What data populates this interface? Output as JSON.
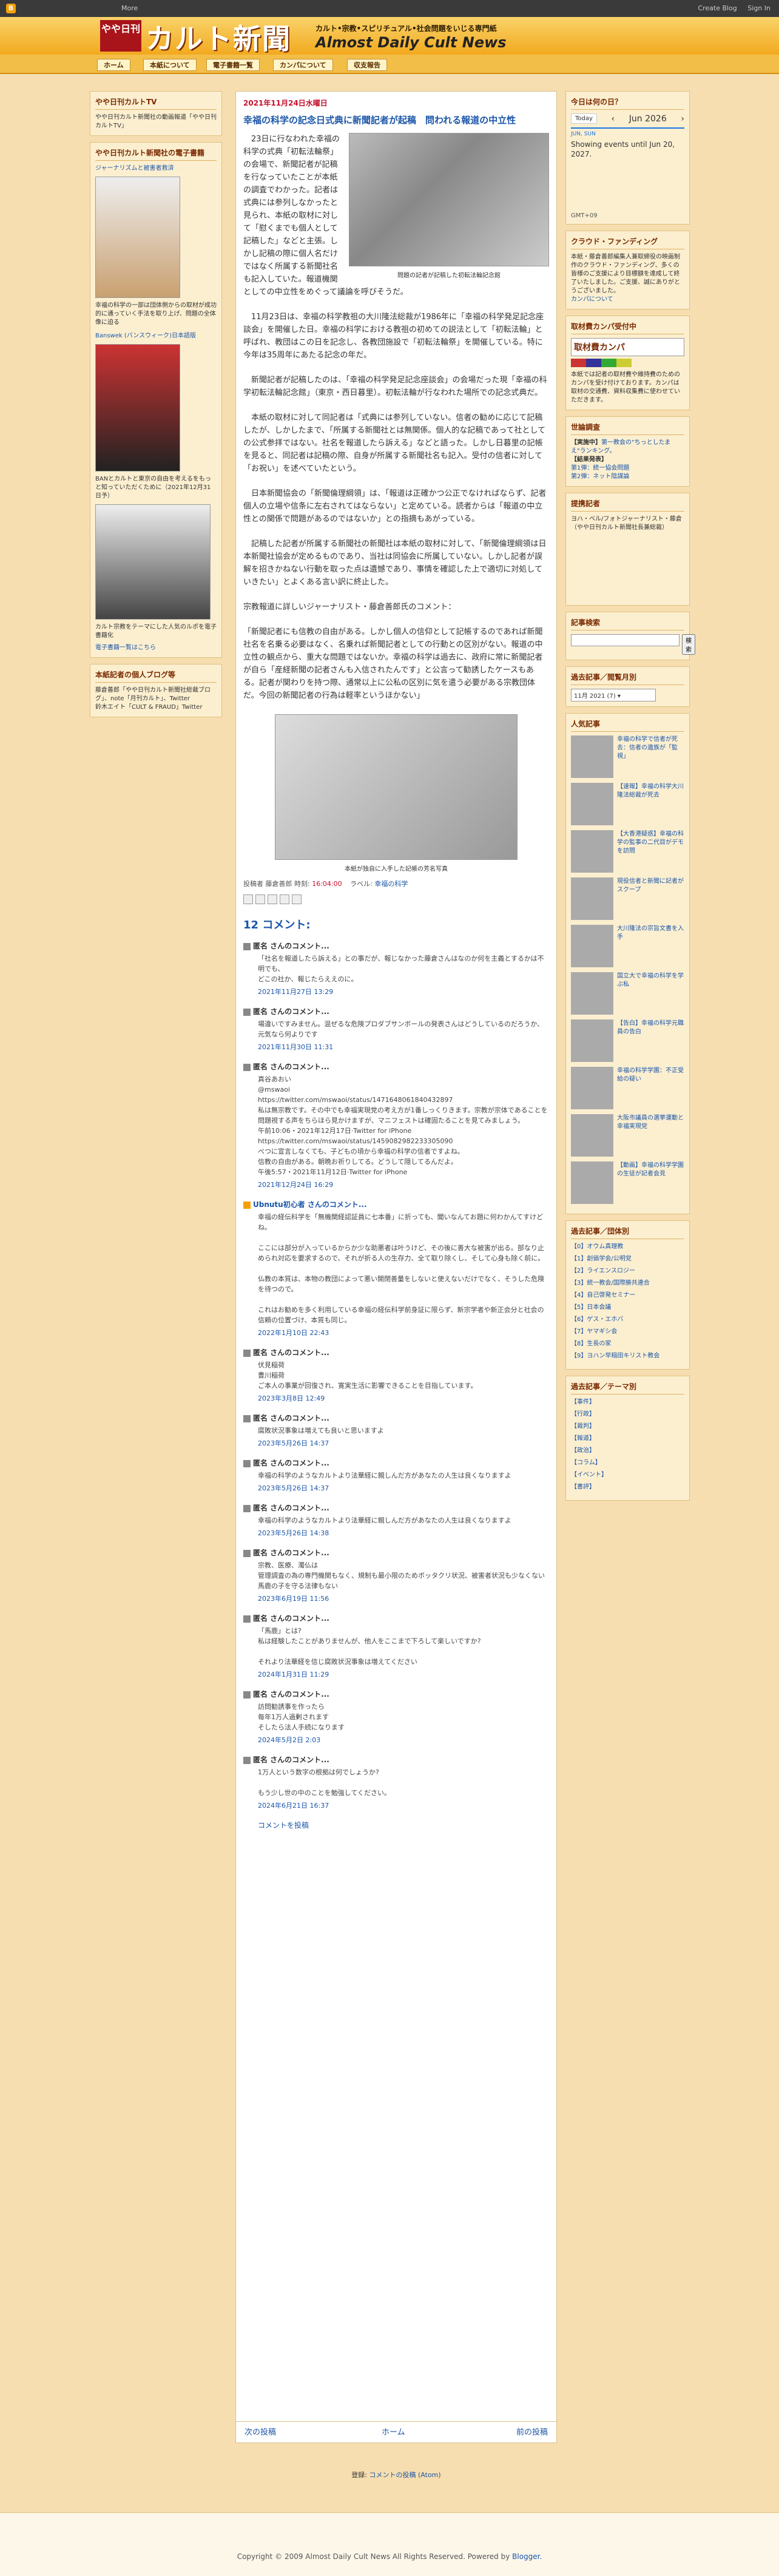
{
  "navbar": {
    "more": "More",
    "create_blog": "Create Blog",
    "sign_in": "Sign In"
  },
  "header": {
    "logo_box": "やや日刊",
    "logo_text": "カルト新聞",
    "tagline": "カルト•宗教•スピリチュアル•社会問題をいじる専門紙",
    "subtitle": "Almost Daily Cult News"
  },
  "tabs": [
    "ホーム",
    "本紙について",
    "電子書籍一覧",
    "カンパについて",
    "収支報告"
  ],
  "left_sidebar": {
    "w1_title": "やや日刊カルトTV",
    "w1_body": "やや日刊カルト新聞社の動画報道「やや日刊カルトTV」",
    "w2_title": "やや日刊カルト新聞社の電子書籍",
    "w2_book1_title": "ジャーナリズムと被害者救済",
    "w2_desc1": "幸福の科学の一部は団体側からの取材が成功的に通っていく手法を取り上げ、問題の全体像に迫る",
    "w2_desc2": "Banswek (バンスウィーク)日本語版",
    "w2_desc3": "BANとカルトと東京の自由を考えるをもっと知っていただくために（2021年12月31日予）",
    "w2_desc4": "カルト宗教をテーマにした人気のルポを電子書籍化",
    "w2_more": "電子書籍一覧はこちら",
    "w3_title": "本紙記者の個人ブログ等",
    "w3_body": "藤倉善郎「やや日刊カルト新聞社総裁ブログ」、note「月刊カルト」、Twitter",
    "w3_body2": "鈴木エイト「CULT & FRAUD」Twitter"
  },
  "post": {
    "date": "2021年11月24日水曜日",
    "title": "幸福の科学の記念日式典に新聞記者が起稿　問われる報道の中立性",
    "photo1_caption": "問題の記者が記稿した初転法輪記念館",
    "p1": "　23日に行なわれた幸福の科学の式典「初転法輪祭」の会場で、新聞記者が記稿を行なっていたことが本紙の調査でわかった。記者は式典には参列しなかったと見られ、本紙の取材に対して「慰くまでも個人として記稿した」などと主張。しかし記稿の際に個人名だけではなく所属する新聞社名も記入していた。報道機関としての中立性をめぐって議論を呼びそうだ。",
    "p2": "　11月23日は、幸福の科学教祖の大川隆法総裁が1986年に「幸福の科学発足記念座談会」を開催した日。幸福の科学における教祖の初めての説法として「初転法輪」と呼ばれ、教団はこの日を記念し、各教団施設で「初転法輪祭」を開催している。特に今年は35周年にあたる記念の年だ。",
    "p3": "　新聞記者が記稿したのは、「幸福の科学発足記念座談会」の会場だった現「幸福の科学初転法輪記念館」（東京・西日暮里）。初転法輪が行なわれた場所での記念式典だ。",
    "p4": "　本紙の取材に対して同記者は「式典には参列していない。信者の勧めに応じて記稿したが、しかしたまで、「所属する新聞社とは無関係。個人的な記稿であって社としての公式参拝ではない。社名を報道したら訴える」などと語った。しかし日暮里の記帳を見ると、同記者は記稿の際、自身が所属する新聞社名も記入。受付の信者に対して「お祝い」を述べていたという。",
    "p5": "　日本新聞協会の「新聞倫理綱領」は、「報道は正確かつ公正でなければならず、記者個人の立場や信条に左右されてはならない」と定めている。読者からは「報道の中立性との関係で問題があるのではないか」との指摘もあがっている。",
    "p6": "　記稿した記者が所属する新聞社の新聞社は本紙の取材に対して、「新聞倫理綱領は日本新聞社協会が定めるものであり、当社は同協会に所属していない。しかし記者が誤解を招きかねない行動を取った点は遺憾であり、事情を確認した上で適切に対処していきたい」とよくある言い訳に終止した。",
    "p7": "宗教報道に詳しいジャーナリスト・藤倉善郎氏のコメント：",
    "p8": "「新聞記者にも信教の自由がある。しかし個人の信仰として記帳するのであれば新聞社名を名乗る必要はなく、名乗れば新聞記者としての行動との区別がない。報道の中立性の観点から、重大な問題ではないか。幸福の科学は過去に、政府に常に新聞記者が自ら「産経新聞の記者さんも入信されたんです」と公言って勧誘したケースもある。記者が関わりを持つ際、通常以上に公私の区別に気を遣う必要がある宗教団体だ。今回の新聞記者の行為は軽率というほかない」",
    "photo2_caption": "本紙が独自に入手した記帳の芳名写真",
    "footer_by": "投稿者 藤倉善郎 時刻:",
    "footer_time": "16:04:00",
    "footer_label": "ラベル:",
    "footer_label_value": "幸福の科学"
  },
  "comments": {
    "heading": "12 コメント:",
    "items": [
      {
        "author": "匿名 さんのコメント...",
        "body": "「社名を報道したら訴える」との事だが、報じなかった藤倉さんはなのか何を主義とするかは不明でも、\nどこの社か、報じたらええのに。",
        "time": "2021年11月27日 13:29"
      },
      {
        "author": "匿名 さんのコメント...",
        "body": "場違いですみません。混ぜるな危険プロダブサンボールの発表さんはどうしているのだろうか、元気なら何よりです",
        "time": "2021年11月30日 11:31"
      },
      {
        "author": "匿名 さんのコメント...",
        "body": "真谷あおい\n@mswaoi\nhttps://twitter.com/mswaoi/status/1471648061840432897\n私は無宗教です。その中でも幸福実現党の考え方が1番しっくりきます。宗教が宗体であることを問題視する声をちらほら見かけますが、マニフェストは確固たることを見てみましょう。\n午前10:06・2021年12月17日·Twitter for iPhone\nhttps://twitter.com/mswaoi/status/1459082982233305090\nべつに宣言しなくても、子どもの頃から幸福の科学の信者ですよね。\n信教の自由がある。朝晩お祈りしてる。どうして隠してるんだよ。\n午後5:57・2021年11月12日·Twitter for iPhone",
        "time": "2021年12月24日 16:29"
      },
      {
        "author": "Ubnutu初心者 さんのコメント...",
        "body": "幸福の経伝科学を「無機関経認証員に七本番」に折っても、聞いなんてお題に何わかんてすけどね。\n\nここには部分が入っているからか少な助悪者は叶うけど、その後に善大な被害が出る。部なり止められ対応を要求するので、それが折る人の生存力、全て取り除くし、そして心身も除く前に。\n\n仏教の本質は、本物の教団によって悪い開閉善量をしないと使えないだけでなく、そうした危険を待つので。\n\nこれはお勧めを多く利用している幸福の経伝科学前身証に限らず、新宗学者や新正会分と社会の信頼の位置づけ、本質も同じ。",
        "time": "2022年1月10日 22:43"
      },
      {
        "author": "匿名 さんのコメント...",
        "body": "伏見稲荷\n豊川稲荷\nご本人の事業が回復され、寛実生活に影響できることを目指しています。",
        "time": "2023年3月8日 12:49"
      },
      {
        "author": "匿名 さんのコメント...",
        "body": "腐敗状況事象は増えても良いと思いますよ",
        "time": "2023年5月26日 14:37"
      },
      {
        "author": "匿名 さんのコメント...",
        "body": "幸福の科学のようなカルトより法華経に親しんだ方があなたの人生は良くなりますよ",
        "time": "2023年5月26日 14:37"
      },
      {
        "author": "匿名 さんのコメント...",
        "body": "幸福の科学のようなカルトより法華経に親しんだ方があなたの人生は良くなりますよ",
        "time": "2023年5月26日 14:38"
      },
      {
        "author": "匿名 さんのコメント...",
        "body": "宗教、医療、濁仏は\n管理調査の為の専門機関もなく、規制も最小限のためボッタクリ状況、被害者状況も少なくない\n馬鹿の子を守る法律もない",
        "time": "2023年6月19日 11:56"
      },
      {
        "author": "匿名 さんのコメント...",
        "body": "「馬鹿」とは?\n私は経験したことがありませんが、他人をここまで下ろして楽しいですか?\n\nそれより法華経を信じ腐敗状況事象は増えてください",
        "time": "2024年1月31日 11:29"
      },
      {
        "author": "匿名 さんのコメント...",
        "body": "訪問勧誘事を作ったら\n毎年1万人過剰されます\nそしたら法人手続になります",
        "time": "2024年5月2日 2:03"
      },
      {
        "author": "匿名 さんのコメント...",
        "body": "1万人という数字の根拠は何でしょうか?\n\nもう少し世の中のことを勉強してください。",
        "time": "2024年6月21日 16:37"
      }
    ],
    "post_link": "コメントを投稿"
  },
  "pager": {
    "newer": "次の投稿",
    "home": "ホーム",
    "older": "前の投稿"
  },
  "subscribe": {
    "label": "登録:",
    "link": "コメントの投稿 (Atom)"
  },
  "right_sidebar": {
    "cal_title": "今日は何の日？",
    "cal_today": "Today",
    "cal_month": "Jun 2026",
    "cal_date_label": "JUN, SUN",
    "cal_empty": "Showing events until Jun 20, 2027.",
    "cal_tz": "GMT+09",
    "cf_title": "クラウド・ファンディング",
    "cf_body": "本紙・藤倉善郎編集人兼取締役の映画制作のクラウド・ファンディング、多くの皆様のご支援により目標額を達成して終了いたしました。ご支援、誠にありがとうございました。",
    "cf_link": "カンパについて",
    "donate_title": "取材費カンパ受付中",
    "donate_box": "取材費カンパ",
    "donate_body": "本紙では記者の取材費や維持費のためのカンパを受け付けております。カンパは取材の交通費、資料収集費に使わせていただきます。",
    "poll_title": "世論調査",
    "poll_q": "【実施中】",
    "poll_body": "第一教会の\"ちっとしたまえ\"ランキング。",
    "poll_result_title": "【結果発表】",
    "poll_r1": "第1弾：統一協会問題",
    "poll_r2": "第2弾：ネット陰謀論",
    "partner_title": "提携記者",
    "partner_body": "ヨハ・ベル/フォトジャーナリスト・藤倉（やや日刊カルト新聞社長兼総裁）",
    "search_title": "記事検索",
    "search_btn": "検索",
    "archive_title": "過去記事／閲覧月別",
    "archive_select": "11月 2021 (7)",
    "popular_title": "人気記事",
    "popular_items": [
      "幸福の科学で信者が死去：信者の遺族が「監視」",
      "【速報】幸福の科学大川隆法総裁が死去",
      "【大香港疑惑】幸福の科学の監事の二代目がデモを訪問",
      "現役信者と新聞に記者がスクープ",
      "大川隆法の宗旨文書を入手",
      "国立大で幸福の科学を学ぶ私",
      "【告白】幸福の科学元職員の告白",
      "幸福の科学学園：不正受給の疑い",
      "大阪市議員の選挙運動と幸福実現党",
      "【動画】幸福の科学学園の生徒が記者会見"
    ],
    "tags_title": "過去記事／団体別",
    "tags": [
      "【0】オウム真理教",
      "【1】創価学会/公明党",
      "【2】ライエンスロジー",
      "【3】統一教会/国際勝共連合",
      "【4】自己啓発セミナー",
      "【5】日本会議",
      "【6】ゲス・エホバ",
      "【7】ヤマギシ会",
      "【8】生長の家",
      "【9】ヨハン早稲田キリスト教会"
    ],
    "theme_title": "過去記事／テーマ別",
    "themes": [
      "【事件】",
      "【行政】",
      "【裁判】",
      "【報道】",
      "【政治】",
      "【コラム】",
      "【イベント】",
      "【書評】"
    ]
  },
  "footer": {
    "copyright": "Copyright © 2009 Almost Daily Cult News All Rights Reserved. Powered by",
    "blogger": "Blogger."
  }
}
